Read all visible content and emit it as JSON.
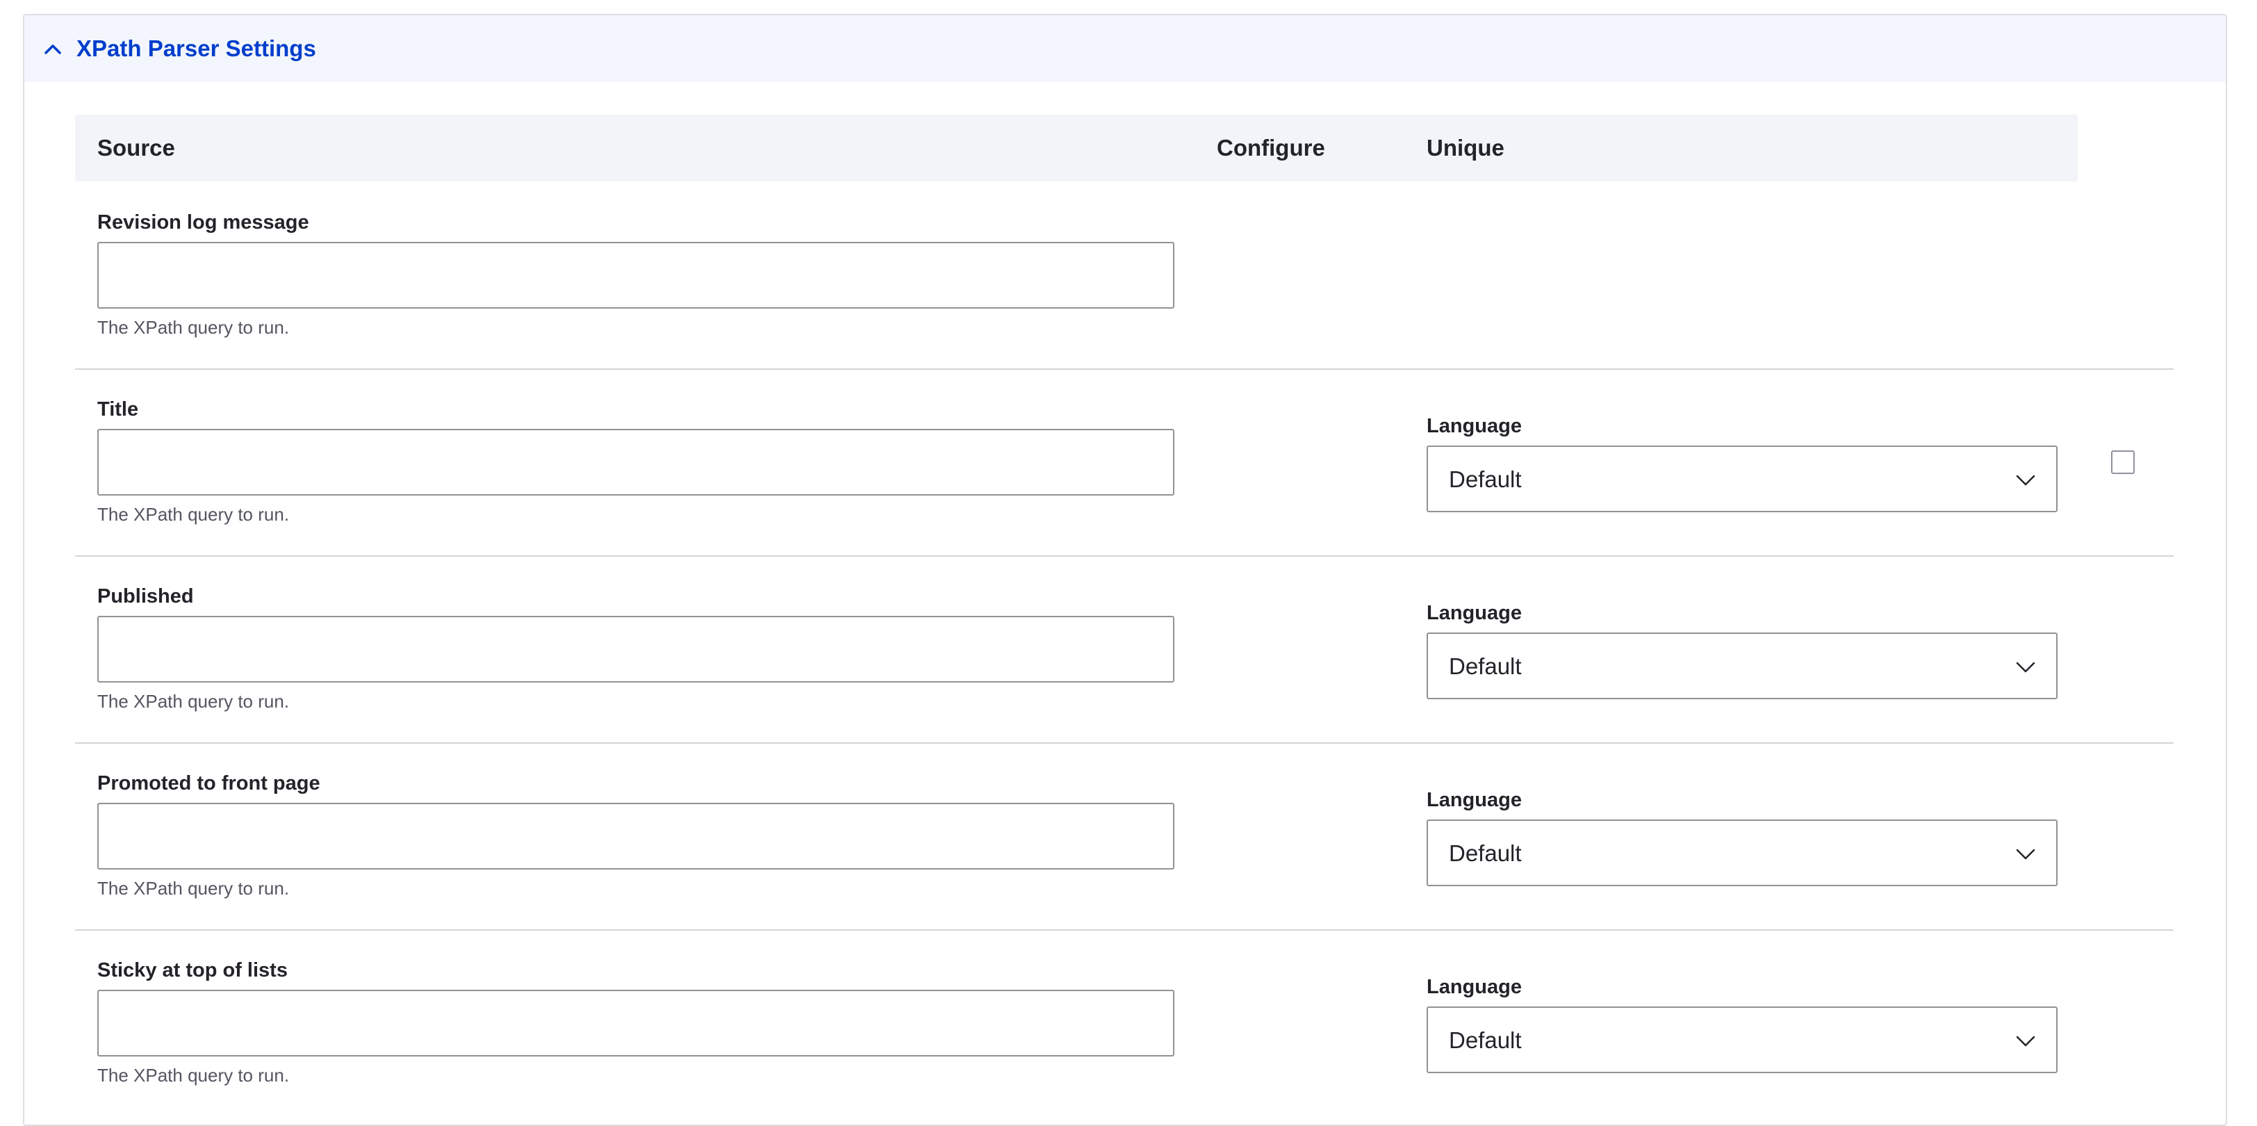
{
  "section": {
    "title": "XPath Parser Settings",
    "expanded": true,
    "accent_color": "#003ecc",
    "toggle_icon": "chevron-up-icon"
  },
  "table": {
    "headers": {
      "source": "Source",
      "configure": "Configure",
      "unique": "Unique"
    },
    "rows": [
      {
        "label": "Revision log message",
        "value": "",
        "description": "The XPath query to run.",
        "has_language": false
      },
      {
        "label": "Title",
        "value": "",
        "description": "The XPath query to run.",
        "has_language": true,
        "language_label": "Language",
        "language_value": "Default",
        "has_unique_checkbox": true,
        "unique_checked": false
      },
      {
        "label": "Published",
        "value": "",
        "description": "The XPath query to run.",
        "has_language": true,
        "language_label": "Language",
        "language_value": "Default"
      },
      {
        "label": "Promoted to front page",
        "value": "",
        "description": "The XPath query to run.",
        "has_language": true,
        "language_label": "Language",
        "language_value": "Default"
      },
      {
        "label": "Sticky at top of lists",
        "value": "",
        "description": "The XPath query to run.",
        "has_language": true,
        "language_label": "Language",
        "language_value": "Default"
      }
    ]
  }
}
